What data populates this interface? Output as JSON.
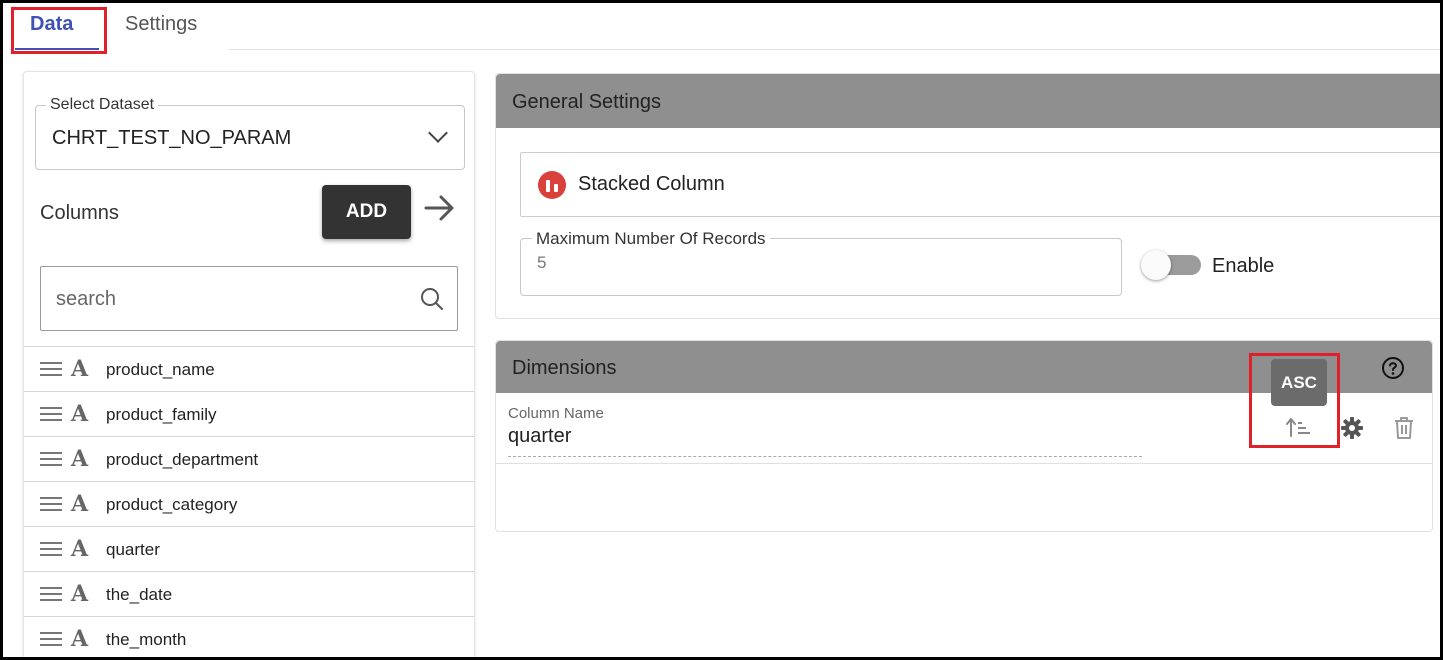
{
  "tabs": [
    {
      "label": "Data",
      "active": true
    },
    {
      "label": "Settings",
      "active": false
    }
  ],
  "dataset": {
    "label": "Select Dataset",
    "value": "CHRT_TEST_NO_PARAM"
  },
  "columns": {
    "label": "Columns",
    "add_label": "ADD",
    "search_placeholder": "search",
    "items": [
      {
        "label": "product_name",
        "type_icon": "A"
      },
      {
        "label": "product_family",
        "type_icon": "A"
      },
      {
        "label": "product_department",
        "type_icon": "A"
      },
      {
        "label": "product_category",
        "type_icon": "A"
      },
      {
        "label": "quarter",
        "type_icon": "A"
      },
      {
        "label": "the_date",
        "type_icon": "A"
      },
      {
        "label": "the_month",
        "type_icon": "A"
      }
    ]
  },
  "general_settings": {
    "title": "General Settings",
    "chart_type": "Stacked Column",
    "max_records_label": "Maximum Number Of Records",
    "max_records_value": "5",
    "enable_label": "Enable",
    "enable_on": false
  },
  "dimensions": {
    "title": "Dimensions",
    "column_name_label": "Column Name",
    "column_name_value": "quarter",
    "sort_tooltip": "ASC"
  },
  "colors": {
    "accent": "#3f51b5",
    "header_bg": "#8f8f8f",
    "highlight": "#e0202b",
    "chart_icon": "#d9413a"
  }
}
